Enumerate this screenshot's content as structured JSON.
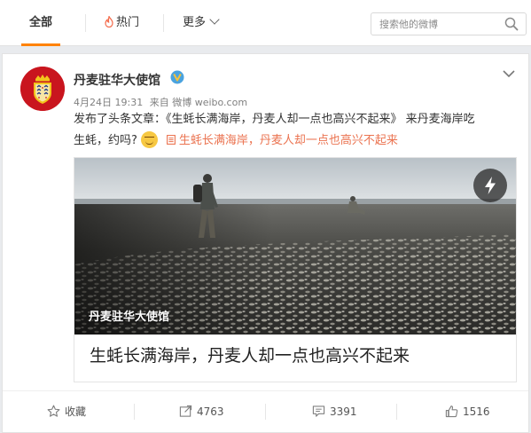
{
  "tabs": {
    "all": "全部",
    "hot": "热门",
    "more": "更多"
  },
  "search": {
    "placeholder": "搜索他的微博"
  },
  "post": {
    "username": "丹麦驻华大使馆",
    "time": "4月24日 19:31",
    "source_prefix": "来自",
    "source": "微博 weibo.com",
    "text_part1": "发布了头条文章：《生蚝长满海岸，丹麦人却一点也高兴不起来》 来丹麦海岸吃",
    "text_part2": "生蚝，约吗?",
    "article_link": "生蚝长满海岸，丹麦人却一点也高兴不起来",
    "article": {
      "watermark": "丹麦驻华大使馆",
      "title": "生蚝长满海岸，丹麦人却一点也高兴不起来"
    }
  },
  "actions": {
    "favorite": "收藏",
    "repost_count": "4763",
    "comment_count": "3391",
    "like_count": "1516"
  },
  "colors": {
    "accent": "#ff8200",
    "link": "#eb7350",
    "verified": "#4aa3df"
  }
}
